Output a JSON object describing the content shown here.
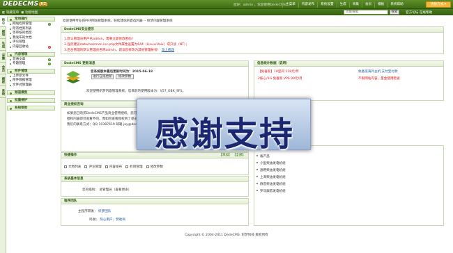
{
  "topbar": {
    "logo": "DEDECMS",
    "version": "V5",
    "links": "您好：admin ，欢迎使用DedeCMS！",
    "nav": [
      "主菜单",
      "内容发布",
      "系统设置",
      "生成",
      "采集",
      "会员",
      "模板",
      "系统帮助"
    ],
    "quick_button": "快捷方式 ▾"
  },
  "subbar": {
    "left_links": [
      "隐藏菜单",
      "功能地图"
    ],
    "search_placeholder": "功能搜索",
    "search_button": "搜索",
    "right_links": "官方论坛    在线帮助"
  },
  "rail": [
    "核心",
    "模块",
    "生成",
    "采集",
    "会员",
    "模板",
    "系统"
  ],
  "sidebar": {
    "sections": [
      {
        "title": "常用操作",
        "items": [
          {
            "label": "网站栏目管理",
            "plus": "green"
          },
          {
            "label": "所有档案列表",
            "plus": ""
          },
          {
            "label": "等审核的档案",
            "plus": ""
          },
          {
            "label": "我发布的文档",
            "plus": ""
          },
          {
            "label": "评论管理",
            "plus": ""
          },
          {
            "label": "内容回收站",
            "plus": "red"
          }
        ]
      },
      {
        "title": "内容管理",
        "items": [
          {
            "label": "普通文章",
            "plus": "green"
          },
          {
            "label": "专题管理",
            "plus": "green"
          }
        ]
      },
      {
        "title": "附件管理",
        "items": [
          {
            "label": "上传新文件",
            "plus": ""
          },
          {
            "label": "附件数据管理",
            "plus": ""
          },
          {
            "label": "文件式管理器",
            "plus": ""
          }
        ]
      },
      {
        "title": "频道模型",
        "items": []
      },
      {
        "title": "批量维护",
        "items": []
      },
      {
        "title": "系统帮助",
        "items": []
      }
    ]
  },
  "main": {
    "breadcrumb": "欢迎使用专业的PHP网站管理系统，轻松建站的首选利器 -- 织梦内容管理系统",
    "security_panel": {
      "title": "DedeCMS安全提示",
      "lines": [
        "1.默认管理员用户名admin，需要立即修改密码！",
        "2.强烈建议data/common.inc.php文件属性设置为644（Linux/Unix）或只读（NT）；",
        "3.后台管理的默认管理员名称admin，建议您修改为其他管理帐号！",
        "马上修改"
      ]
    },
    "update_panel": {
      "title": "DedeCMS 更新消息",
      "line1": "您系统版本最后更新时间为：2015-06-18",
      "btn_update": "进行在线更新",
      "btn_mod": "修改参数",
      "line2": "欢迎使用织梦内容管理系统，您目前的使用版本为：V57_GBK_SP1。"
    },
    "biz_panel": {
      "title": "商业授权咨询",
      "lines": [
        "如果您已购买DedeCMS产品商业使用授权，您可以",
        "授权内容即可查看不同，而如何查看授权到了单击",
        "我们的联系方式：QQ 10387619 邮箱 jay@dedecms"
      ]
    },
    "quick_panel": {
      "title": "快捷操作",
      "right": "【添加】 【全部】",
      "items": [
        "文档列表",
        "评论管理",
        "内容发布",
        "栏目管理",
        "修改参数"
      ]
    },
    "sysinfo_panel": {
      "title": "系统基本信息",
      "label": "您的级别：",
      "value": "总管理员（查看更多）"
    },
    "team_panel": {
      "title": "程序团队",
      "rows": [
        {
          "label": "主程序研发：",
          "value": "织梦团队"
        },
        {
          "label": "鸣谢：",
          "value": "热心用户、赞助商"
        }
      ]
    }
  },
  "right": {
    "info_panel": {
      "title": "信息统计数据（说明）",
      "rows": [
        {
          "a": "【免备案】10空间 128元/年",
          "b": "免备案海外主机 支付宝付款"
        },
        {
          "a": "2核心/1G 免备案 VPS 99元/月",
          "b": "不限网站内容，量金使用稳速"
        }
      ]
    },
    "list_panel": {
      "items": [
        "备产品",
        "小型柴油发电机组",
        "通用柴油发电机组",
        "上海柴油发电机组",
        "静音柴油发电机组",
        "罗马康宏发电机组"
      ]
    }
  },
  "overlay": {
    "text": "感谢支持"
  },
  "footer": "Copyright © 2004-2011 DedeCMS. 织梦科技 版权所有",
  "colors": {
    "accent": "#3f6d14",
    "warning": "#dd1111",
    "overlay_text": "#1b2770"
  }
}
